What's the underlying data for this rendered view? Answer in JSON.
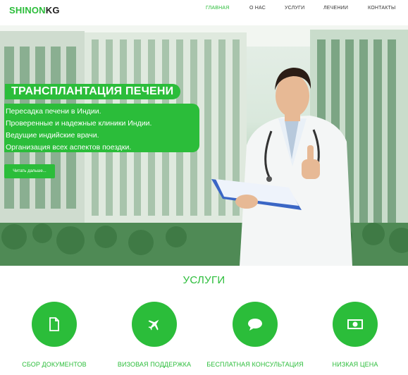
{
  "brand": {
    "part1": "SHINON",
    "part2": "KG"
  },
  "nav": [
    {
      "label": "ГЛАВНАЯ",
      "active": true
    },
    {
      "label": "О НАС",
      "active": false
    },
    {
      "label": "УСЛУГИ",
      "active": false
    },
    {
      "label": "ЛЕЧЕНИИ",
      "active": false
    },
    {
      "label": "КОНТАКТЫ",
      "active": false
    }
  ],
  "hero": {
    "title": "ТРАНСПЛАНТАЦИЯ ПЕЧЕНИ",
    "lines": [
      "Пересадка печени в Индии.",
      "Проверенные и надежные клиники Индии.",
      "Ведущие индийские врачи.",
      "Организация всех аспектов поездки."
    ],
    "button": "Читать дальше..."
  },
  "services": {
    "title": "УСЛУГИ",
    "items": [
      {
        "label": "СБОР ДОКУМЕНТОВ",
        "icon": "document-icon"
      },
      {
        "label": "ВИЗОВАЯ ПОДДЕРЖКА",
        "icon": "airplane-icon"
      },
      {
        "label": "БЕСПЛАТНАЯ КОНСУЛЬТАЦИЯ",
        "icon": "chat-icon"
      },
      {
        "label": "НИЗКАЯ ЦЕНА",
        "icon": "money-icon"
      }
    ]
  },
  "colors": {
    "accent": "#2bbd3a",
    "text": "#333333"
  }
}
